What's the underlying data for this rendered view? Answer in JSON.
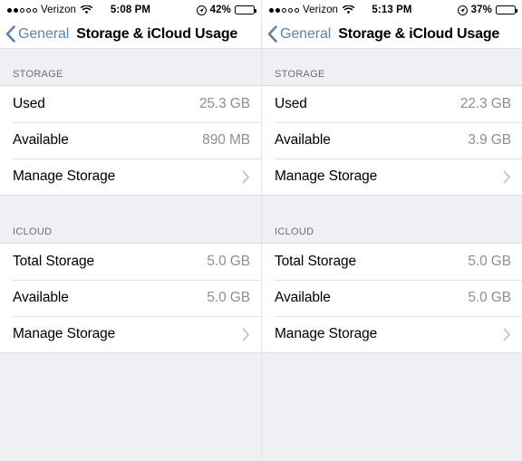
{
  "panels": [
    {
      "status_bar": {
        "signal_dots_filled": 2,
        "signal_dots_total": 5,
        "carrier": "Verizon",
        "wifi_icon": "wifi-icon",
        "time": "5:08 PM",
        "location_icon": "location-services-icon",
        "battery_percent": "42%",
        "battery_level": 42
      },
      "nav": {
        "back_icon": "chevron-left-icon",
        "back_label": "General",
        "title": "Storage & iCloud Usage"
      },
      "sections": [
        {
          "header": "STORAGE",
          "rows": [
            {
              "label": "Used",
              "value": "25.3 GB",
              "type": "value"
            },
            {
              "label": "Available",
              "value": "890 MB",
              "type": "value"
            },
            {
              "label": "Manage Storage",
              "value": "",
              "type": "disclosure",
              "icon": "chevron-right-icon"
            }
          ]
        },
        {
          "header": "ICLOUD",
          "rows": [
            {
              "label": "Total Storage",
              "value": "5.0 GB",
              "type": "value"
            },
            {
              "label": "Available",
              "value": "5.0 GB",
              "type": "value"
            },
            {
              "label": "Manage Storage",
              "value": "",
              "type": "disclosure",
              "icon": "chevron-right-icon"
            }
          ]
        }
      ]
    },
    {
      "status_bar": {
        "signal_dots_filled": 2,
        "signal_dots_total": 5,
        "carrier": "Verizon",
        "wifi_icon": "wifi-icon",
        "time": "5:13 PM",
        "location_icon": "location-services-icon",
        "battery_percent": "37%",
        "battery_level": 37
      },
      "nav": {
        "back_icon": "chevron-left-icon",
        "back_label": "General",
        "title": "Storage & iCloud Usage"
      },
      "sections": [
        {
          "header": "STORAGE",
          "rows": [
            {
              "label": "Used",
              "value": "22.3 GB",
              "type": "value"
            },
            {
              "label": "Available",
              "value": "3.9 GB",
              "type": "value"
            },
            {
              "label": "Manage Storage",
              "value": "",
              "type": "disclosure",
              "icon": "chevron-right-icon"
            }
          ]
        },
        {
          "header": "ICLOUD",
          "rows": [
            {
              "label": "Total Storage",
              "value": "5.0 GB",
              "type": "value"
            },
            {
              "label": "Available",
              "value": "5.0 GB",
              "type": "value"
            },
            {
              "label": "Manage Storage",
              "value": "",
              "type": "disclosure",
              "icon": "chevron-right-icon"
            }
          ]
        }
      ]
    }
  ],
  "colors": {
    "tint_blue": "#5f83a8",
    "group_background": "#ffffff",
    "page_background": "#EFEFF4",
    "secondary_text": "#8e8e93",
    "header_text": "#6d6d72",
    "separator": "#e0e0e4"
  }
}
